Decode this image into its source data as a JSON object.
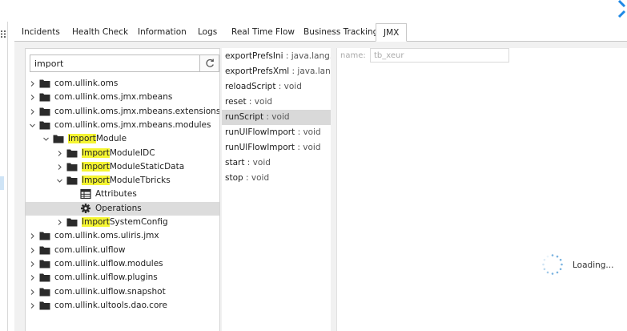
{
  "colors": {
    "highlight": "#f5f532",
    "selected_row": "#dcdcdc",
    "logo_blue": "#1e88e5",
    "content_bg": "#f1f1f1"
  },
  "tabs": [
    {
      "label": "Incidents",
      "active": false
    },
    {
      "label": "Health Check",
      "active": false
    },
    {
      "label": "Information",
      "active": false
    },
    {
      "label": "Logs",
      "active": false
    },
    {
      "label": "Real Time Flow",
      "active": false
    },
    {
      "label": "Business Tracking",
      "active": false
    },
    {
      "label": "JMX",
      "active": true
    }
  ],
  "search": {
    "value": "import",
    "refresh_icon": "refresh-icon"
  },
  "tree": [
    {
      "pre": "",
      "hl": "",
      "post": "com.ullink.oms",
      "icon": "folder-icon",
      "expanded": false,
      "level": 0
    },
    {
      "pre": "",
      "hl": "",
      "post": "com.ullink.oms.jmx.mbeans",
      "icon": "folder-icon",
      "expanded": false,
      "level": 0
    },
    {
      "pre": "",
      "hl": "",
      "post": "com.ullink.oms.jmx.mbeans.extensions",
      "icon": "folder-icon",
      "expanded": false,
      "level": 0
    },
    {
      "pre": "",
      "hl": "",
      "post": "com.ullink.oms.jmx.mbeans.modules",
      "icon": "folder-icon",
      "expanded": true,
      "level": 0
    },
    {
      "pre": "",
      "hl": "Import",
      "post": "Module",
      "icon": "folder-icon",
      "expanded": true,
      "level": 1
    },
    {
      "pre": "",
      "hl": "Import",
      "post": "ModuleIDC",
      "icon": "folder-icon",
      "expanded": false,
      "level": 2
    },
    {
      "pre": "",
      "hl": "Import",
      "post": "ModuleStaticData",
      "icon": "folder-icon",
      "expanded": false,
      "level": 2
    },
    {
      "pre": "",
      "hl": "Import",
      "post": "ModuleTbricks",
      "icon": "folder-icon",
      "expanded": true,
      "level": 2
    },
    {
      "pre": "",
      "hl": "",
      "post": "Attributes",
      "icon": "table-icon",
      "expanded": null,
      "level": 3
    },
    {
      "pre": "",
      "hl": "",
      "post": "Operations",
      "icon": "gear-icon",
      "expanded": null,
      "level": 3,
      "selected": true
    },
    {
      "pre": "",
      "hl": "Import",
      "post": "SystemConfig",
      "icon": "folder-icon",
      "expanded": false,
      "level": 2
    },
    {
      "pre": "",
      "hl": "",
      "post": "com.ullink.oms.uliris.jmx",
      "icon": "folder-icon",
      "expanded": false,
      "level": 0
    },
    {
      "pre": "",
      "hl": "",
      "post": "com.ullink.ulflow",
      "icon": "folder-icon",
      "expanded": false,
      "level": 0
    },
    {
      "pre": "",
      "hl": "",
      "post": "com.ullink.ulflow.modules",
      "icon": "folder-icon",
      "expanded": false,
      "level": 0
    },
    {
      "pre": "",
      "hl": "",
      "post": "com.ullink.ulflow.plugins",
      "icon": "folder-icon",
      "expanded": false,
      "level": 0
    },
    {
      "pre": "",
      "hl": "",
      "post": "com.ullink.ulflow.snapshot",
      "icon": "folder-icon",
      "expanded": false,
      "level": 0
    },
    {
      "pre": "",
      "hl": "",
      "post": "com.ullink.ultools.dao.core",
      "icon": "folder-icon",
      "expanded": false,
      "level": 0
    }
  ],
  "operations": [
    {
      "name": "exportPrefsIni",
      "type": " : java.lang.Stri"
    },
    {
      "name": "exportPrefsXml",
      "type": " : java.lang.St"
    },
    {
      "name": "reloadScript",
      "type": " : void"
    },
    {
      "name": "reset",
      "type": " : void"
    },
    {
      "name": "runScript",
      "type": " : void",
      "selected": true
    },
    {
      "name": "runUIFlowImport",
      "type": " : void"
    },
    {
      "name": "runUlFlowImport",
      "type": " : void"
    },
    {
      "name": "start",
      "type": " : void"
    },
    {
      "name": "stop",
      "type": " : void"
    }
  ],
  "detail": {
    "name_label": "name:",
    "name_value": "tb_xeur",
    "loading_text": "Loading..."
  }
}
